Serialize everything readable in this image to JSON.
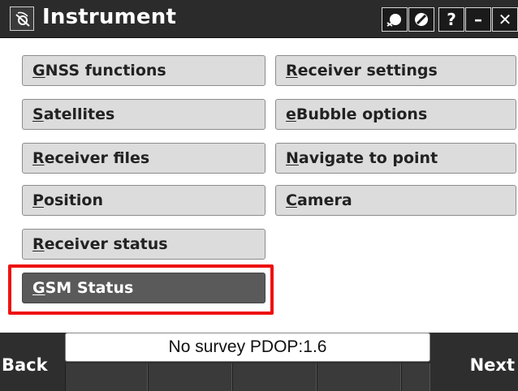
{
  "window": {
    "title": "Instrument",
    "logo_icon": "antenna-logo-icon",
    "buttons": [
      {
        "name": "gnss-status-icon",
        "label": ""
      },
      {
        "name": "no-entry-icon",
        "label": ""
      },
      {
        "name": "help-button",
        "label": "?"
      },
      {
        "name": "minimize-button",
        "label": "–"
      },
      {
        "name": "close-button",
        "label": "✕"
      }
    ]
  },
  "menu": {
    "left": [
      {
        "underline": "G",
        "rest": "NSS functions"
      },
      {
        "underline": "S",
        "rest": "atellites"
      },
      {
        "underline": "R",
        "rest": "eceiver files"
      },
      {
        "underline": "P",
        "rest": "osition"
      },
      {
        "underline": "R",
        "rest": "eceiver status"
      },
      {
        "underline": "G",
        "rest": "SM Status"
      }
    ],
    "right": [
      {
        "underline": "R",
        "rest": "eceiver settings"
      },
      {
        "underline": "e",
        "rest": "Bubble options"
      },
      {
        "underline": "N",
        "rest": "avigate to point"
      },
      {
        "underline": "C",
        "rest": "amera"
      }
    ],
    "selected": "GSM Status",
    "highlight_color": "#ee1111"
  },
  "status_bar": {
    "text": "No survey  PDOP:1.6"
  },
  "footer": {
    "back_label": "Back",
    "next_label": "Next"
  }
}
